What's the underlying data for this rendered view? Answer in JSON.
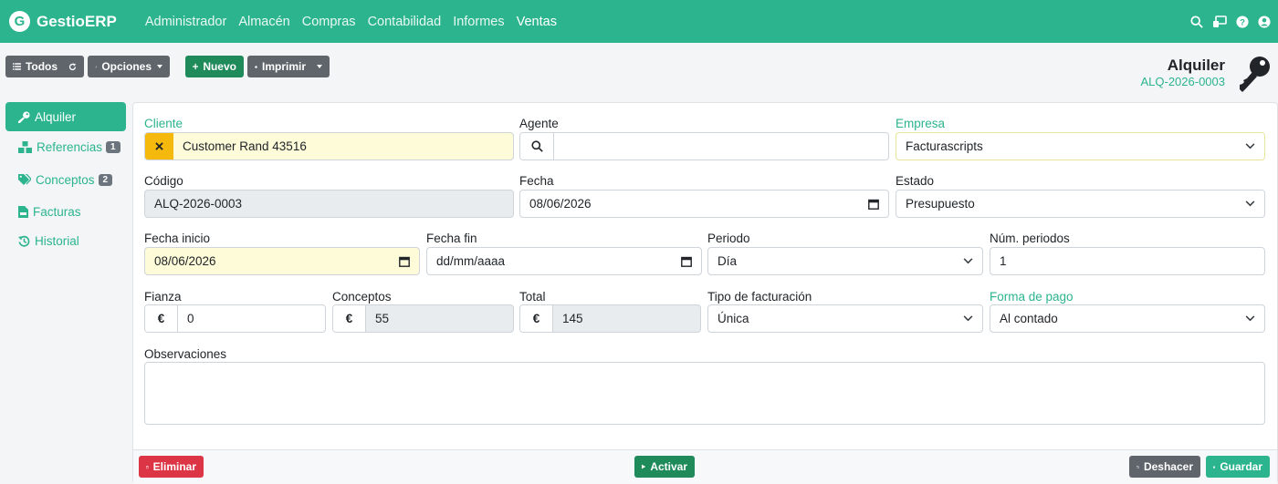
{
  "app": {
    "logo_letter": "G",
    "name": "GestioERP"
  },
  "menu": [
    "Administrador",
    "Almacén",
    "Compras",
    "Contabilidad",
    "Informes",
    "Ventas"
  ],
  "menu_active": "Ventas",
  "nav_icons": [
    "search-icon",
    "remote-desktop-icon",
    "help-icon",
    "user-icon"
  ],
  "toolbar": {
    "todos": "Todos",
    "opciones": "Opciones",
    "nuevo": "Nuevo",
    "imprimir": "Imprimir"
  },
  "header": {
    "title": "Alquiler",
    "code": "ALQ-2026-0003"
  },
  "sidebar": [
    {
      "label": "Alquiler",
      "icon": "key-icon"
    },
    {
      "label": "Referencias",
      "icon": "boxes-icon",
      "badge": "1"
    },
    {
      "label": "Conceptos",
      "icon": "tags-icon",
      "badge": "2"
    },
    {
      "label": "Facturas",
      "icon": "file-invoice-icon"
    },
    {
      "label": "Historial",
      "icon": "history-icon"
    }
  ],
  "form": {
    "cliente": {
      "label": "Cliente",
      "value": "Customer Rand 43516"
    },
    "agente": {
      "label": "Agente",
      "value": ""
    },
    "empresa": {
      "label": "Empresa",
      "value": "Facturascripts"
    },
    "codigo": {
      "label": "Código",
      "value": "ALQ-2026-0003"
    },
    "fecha": {
      "label": "Fecha",
      "value": "08/06/2026"
    },
    "estado": {
      "label": "Estado",
      "value": "Presupuesto"
    },
    "fecha_inicio": {
      "label": "Fecha inicio",
      "value": "08/06/2026"
    },
    "fecha_fin": {
      "label": "Fecha fin",
      "value": "dd/mm/aaaa"
    },
    "periodo": {
      "label": "Periodo",
      "value": "Día"
    },
    "num_periodos": {
      "label": "Núm. periodos",
      "value": "1"
    },
    "fianza": {
      "label": "Fianza",
      "value": "0"
    },
    "conceptos": {
      "label": "Conceptos",
      "value": "55"
    },
    "total": {
      "label": "Total",
      "value": "145"
    },
    "tipo_facturacion": {
      "label": "Tipo de facturación",
      "value": "Única"
    },
    "forma_pago": {
      "label": "Forma de pago",
      "value": "Al contado"
    },
    "observaciones": {
      "label": "Observaciones",
      "value": ""
    },
    "currency": "€"
  },
  "footer": {
    "eliminar": "Eliminar",
    "activar": "Activar",
    "deshacer": "Deshacer",
    "guardar": "Guardar"
  },
  "colors": {
    "brand": "#2bb48e",
    "danger": "#dc3545",
    "success": "#1f8a5a",
    "secondary": "#5f656b",
    "highlight": "#fdfbd8"
  }
}
